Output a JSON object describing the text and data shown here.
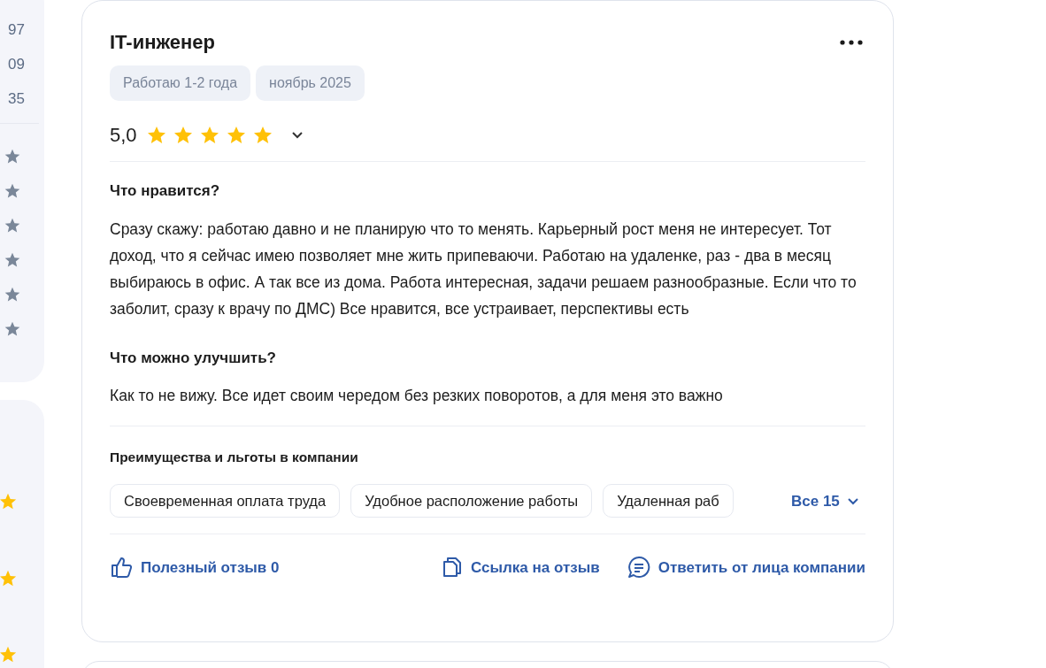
{
  "sidebar": {
    "numbers": [
      "97",
      "09",
      "35"
    ]
  },
  "review": {
    "title": "IT-инженер",
    "tags": [
      "Работаю 1-2 года",
      "ноябрь 2025"
    ],
    "rating": "5,0",
    "stars": 5,
    "expanded": false,
    "sections": [
      {
        "heading": "Что нравится?",
        "text": "Сразу скажу: работаю давно и не планирую что то менять. Карьерный рост меня не интересует. Тот доход, что я сейчас имею позволяет мне жить припеваючи. Работаю на удаленке, раз - два в месяц выбираюсь в офис. А так все из дома. Работа интересная, задачи решаем разнообразные. Если что то заболит, сразу к врачу по ДМС) Все нравится, все устраивает, перспективы есть"
      },
      {
        "heading": "Что можно улучшить?",
        "text": "Как то не вижу. Все идет своим чередом без резких поворотов, а для меня это важно"
      }
    ],
    "benefits": {
      "heading": "Преимущества и льготы в компании",
      "items": [
        "Своевременная оплата труда",
        "Удобное расположение работы",
        "Удаленная раб"
      ],
      "more": "Все 15"
    },
    "actions": [
      {
        "kind": "like",
        "label": "Полезный отзыв 0"
      },
      {
        "kind": "link",
        "label": "Ссылка на отзыв"
      },
      {
        "kind": "reply",
        "label": "Ответить от лица компании"
      }
    ]
  }
}
